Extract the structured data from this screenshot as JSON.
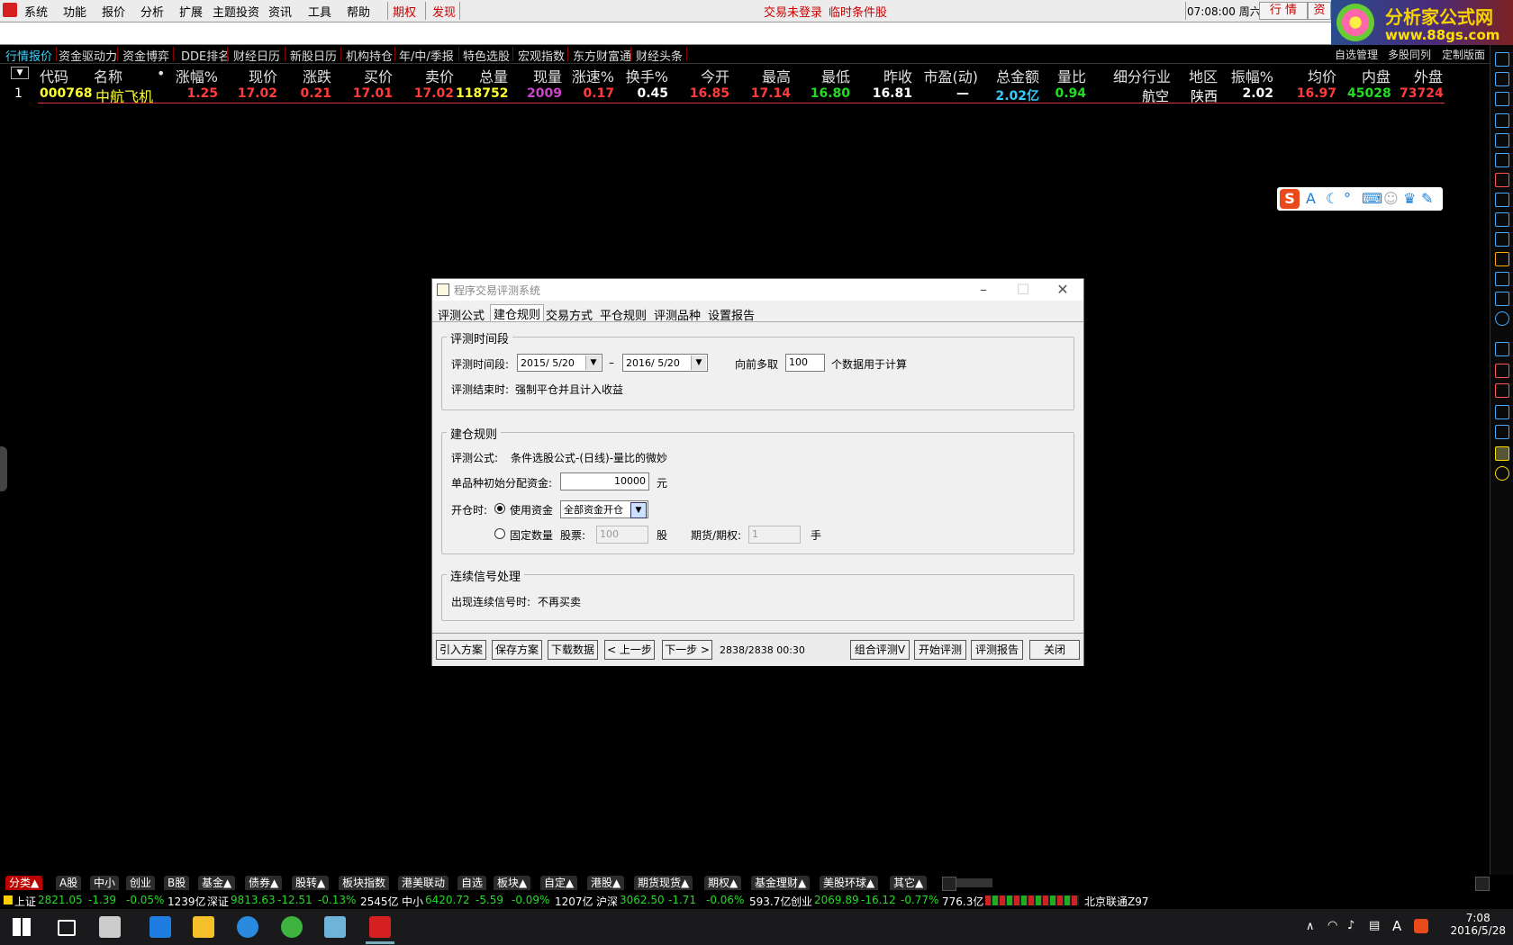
{
  "menubar": {
    "items": [
      "系统",
      "功能",
      "报价",
      "分析",
      "扩展",
      "主题投资",
      "资讯",
      "工具",
      "帮助"
    ],
    "extra": [
      "期权",
      "发现"
    ],
    "status1": "交易未登录",
    "status2": "临时条件股",
    "time": "07:08:00 周六",
    "btn_quote": "行  情",
    "btn_trade": "资"
  },
  "logo": {
    "line1": "分析家公式网",
    "line2": "www.88gs.com"
  },
  "tabs": [
    "行情报价",
    "资金驱动力",
    "资金博弈",
    "DDE排名",
    "财经日历",
    "新股日历",
    "机构持仓",
    "年/中/季报",
    "特色选股",
    "宏观指数",
    "东方财富通",
    "财经头条"
  ],
  "right_tabs": [
    "自选管理",
    "多股同列",
    "定制版面"
  ],
  "table": {
    "headers": [
      "代码",
      "名称",
      "•",
      "涨幅%",
      "现价",
      "涨跌",
      "买价",
      "卖价",
      "总量",
      "现量",
      "涨速%",
      "换手%",
      "今开",
      "最高",
      "最低",
      "昨收",
      "市盈(动)",
      "总金额",
      "量比",
      "细分行业",
      "地区",
      "振幅%",
      "均价",
      "内盘",
      "外盘"
    ],
    "rows": [
      [
        "1",
        "000768",
        "中航飞机",
        "",
        "1.25",
        "17.02",
        "0.21",
        "17.01",
        "17.02",
        "118752",
        "2009",
        "0.17",
        "0.45",
        "16.85",
        "17.14",
        "16.80",
        "16.81",
        "—",
        "2.02亿",
        "0.94",
        "航空",
        "陕西",
        "2.02",
        "16.97",
        "45028",
        "73724"
      ]
    ]
  },
  "colors": {
    "up": "#ff3b3b",
    "down": "#22dd22",
    "yellow": "#ffff33",
    "cyan": "#33ccff",
    "magenta": "#cc44cc",
    "white": "#ffffff"
  },
  "dialog": {
    "title": "程序交易评测系统",
    "tabs": [
      "评测公式",
      "建仓规则",
      "交易方式",
      "平仓规则",
      "评测品种",
      "设置报告"
    ],
    "active_tab": "建仓规则",
    "group1": {
      "title": "评测时间段",
      "period_label": "评测时间段:",
      "start": "2015/ 5/20",
      "dash": "–",
      "end": "2016/ 5/20",
      "lookback_label": "向前多取",
      "lookback_value": "100",
      "lookback_suffix": "个数据用于计算",
      "end_label": "评测结束时:",
      "end_value": "强制平仓并且计入收益"
    },
    "group2": {
      "title": "建仓规则",
      "formula_label": "评测公式:",
      "formula_value": "条件选股公式-(日线)-量比的微妙",
      "capital_label": "单品种初始分配资金:",
      "capital_value": "10000",
      "capital_unit": "元",
      "open_label": "开仓时:",
      "use_fund": "使用资金",
      "fund_option": "全部资金开仓",
      "fixed_qty": "固定数量",
      "stock_label": "股票:",
      "stock_value": "100",
      "stock_unit": "股",
      "futures_label": "期货/期权:",
      "futures_value": "1",
      "futures_unit": "手"
    },
    "group3": {
      "title": "连续信号处理",
      "label": "出现连续信号时:",
      "value": "不再买卖"
    },
    "buttons": {
      "import": "引入方案",
      "save": "保存方案",
      "download": "下载数据",
      "prev": "< 上一步",
      "next": "下一步 >",
      "progress": "2838/2838 00:30",
      "combo": "组合评测V",
      "start": "开始评测",
      "report": "评测报告",
      "close": "关闭"
    }
  },
  "sector_tabs": [
    "分类▲",
    "A股",
    "中小",
    "创业",
    "B股",
    "基金▲",
    "债券▲",
    "股转▲",
    "板块指数",
    "港美联动",
    "自选",
    "板块▲",
    "自定▲",
    "港股▲",
    "期货现货▲",
    "期权▲",
    "基金理财▲",
    "美股环球▲",
    "其它▲"
  ],
  "ticker": [
    {
      "name": "上证",
      "price": "2821.05",
      "chg": "-1.39",
      "pct": "-0.05%",
      "amt": "1239亿"
    },
    {
      "name": "深证",
      "price": "9813.63",
      "chg": "-12.51",
      "pct": "-0.13%",
      "amt": "2545亿"
    },
    {
      "name": "中小",
      "price": "6420.72",
      "chg": "-5.59",
      "pct": "-0.09%",
      "amt": "1207亿"
    },
    {
      "name": "沪深",
      "price": "3062.50",
      "chg": "-1.71",
      "pct": "-0.06%",
      "amt": "593.7亿"
    },
    {
      "name": "创业",
      "price": "2069.89",
      "chg": "-16.12",
      "pct": "-0.77%",
      "amt": "776.3亿"
    }
  ],
  "server": "北京联通Z97",
  "taskbar": {
    "time": "7:08",
    "date": "2016/5/28",
    "ime": "A"
  }
}
